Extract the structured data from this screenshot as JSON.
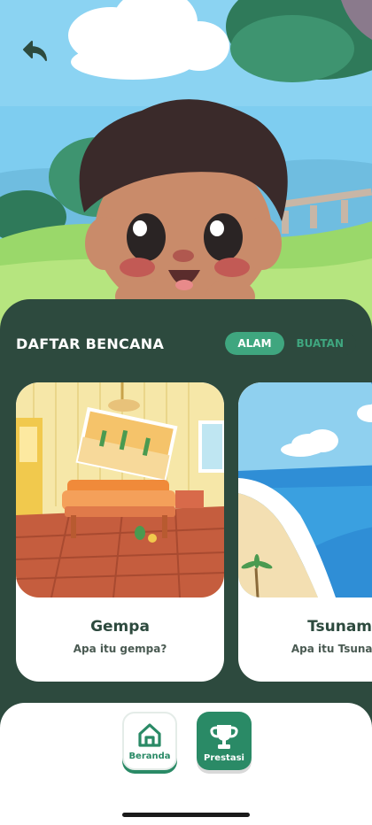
{
  "panel": {
    "title": "DAFTAR BENCANA",
    "tabs": [
      {
        "label": "ALAM",
        "active": true
      },
      {
        "label": "BUATAN",
        "active": false
      }
    ]
  },
  "cards": [
    {
      "title": "Gempa",
      "subtitle": "Apa itu gempa?"
    },
    {
      "title": "Tsunami",
      "subtitle": "Apa itu Tsunami?"
    }
  ],
  "nav": {
    "home_label": "Beranda",
    "achievements_label": "Prestasi"
  },
  "colors": {
    "panel": "#2d4a3e",
    "accent": "#3fa67f",
    "nav_green": "#2a8a66"
  },
  "icons": {
    "back": "back-arrow-icon",
    "home": "home-icon",
    "achievements": "trophy-icon"
  }
}
